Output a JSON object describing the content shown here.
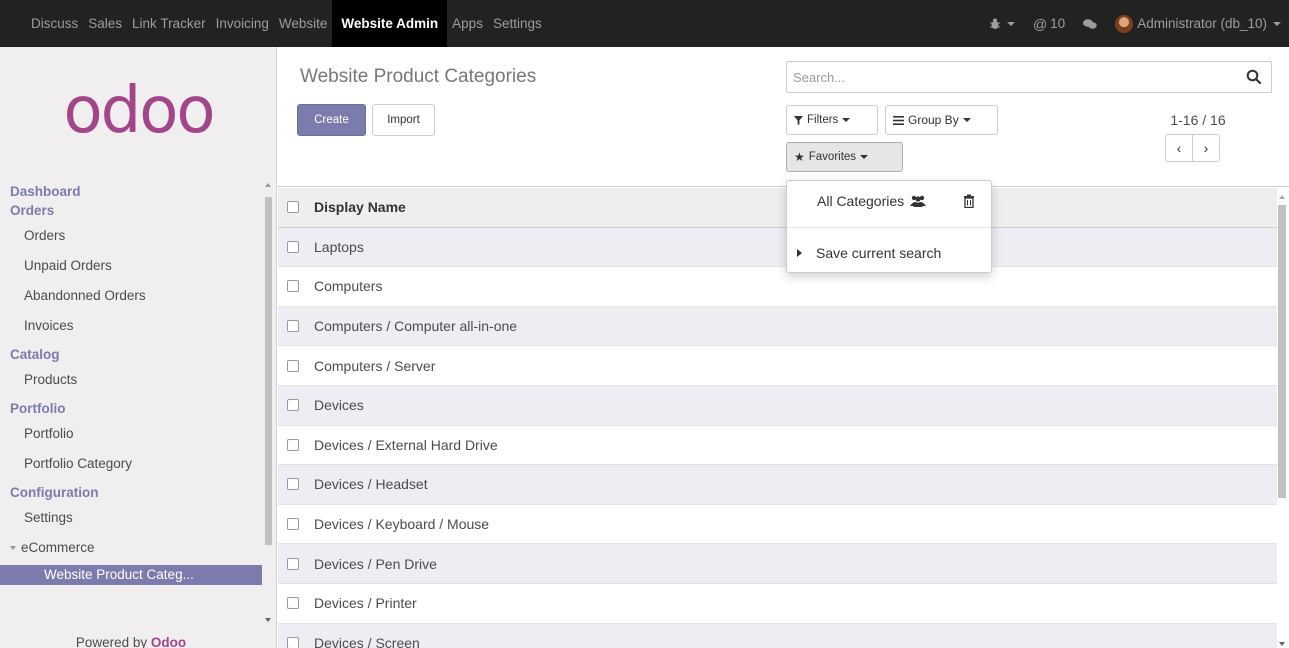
{
  "topnav": {
    "items": [
      "Discuss",
      "Sales",
      "Link Tracker",
      "Invoicing",
      "Website",
      "Website Admin",
      "Apps",
      "Settings"
    ],
    "active": "Website Admin",
    "messages_count": "10",
    "user": "Administrator (db_10)"
  },
  "sidebar": {
    "logo": "odoo",
    "sections": [
      {
        "head": "Dashboard"
      },
      {
        "head": "Orders",
        "items": [
          "Orders",
          "Unpaid Orders",
          "Abandonned Orders",
          "Invoices"
        ]
      },
      {
        "head": "Catalog",
        "items": [
          "Products"
        ]
      },
      {
        "head": "Portfolio",
        "items": [
          "Portfolio",
          "Portfolio Category"
        ]
      },
      {
        "head": "Configuration",
        "items": [
          "Settings"
        ]
      }
    ],
    "ecommerce": "eCommerce",
    "active_item": "Website Product Categ...",
    "powered_by": "Powered by",
    "powered_brand": "Odoo"
  },
  "control_panel": {
    "title": "Website Product Categories",
    "create_label": "Create",
    "import_label": "Import",
    "search_placeholder": "Search...",
    "filters_label": "Filters",
    "groupby_label": "Group By",
    "favorites_label": "Favorites",
    "pager": "1-16 / 16"
  },
  "favorites_menu": {
    "item1": "All Categories",
    "item2": "Save current search"
  },
  "table": {
    "header": "Display Name",
    "rows": [
      "Laptops",
      "Computers",
      "Computers / Computer all-in-one",
      "Computers / Server",
      "Devices",
      "Devices / External Hard Drive",
      "Devices / Headset",
      "Devices / Keyboard / Mouse",
      "Devices / Pen Drive",
      "Devices / Printer",
      "Devices / Screen"
    ]
  }
}
